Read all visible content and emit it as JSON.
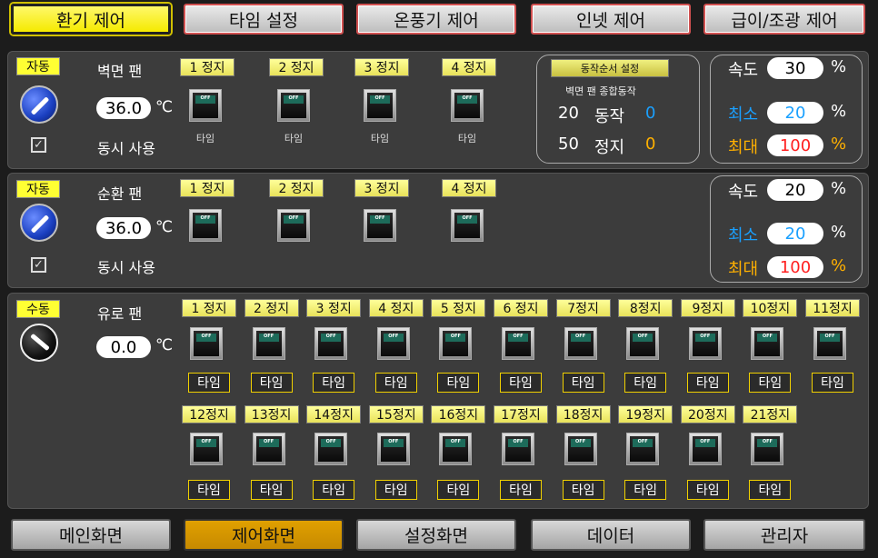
{
  "top_tabs": [
    "환기 제어",
    "타임 설정",
    "온풍기 제어",
    "인넷 제어",
    "급이/조광 제어"
  ],
  "bottom_tabs": [
    "메인화면",
    "제어화면",
    "설정화면",
    "데이터",
    "관리자"
  ],
  "panel1": {
    "mode": "자동",
    "title": "벽면 팬",
    "temp": "36.0",
    "unit": "℃",
    "sync_label": "동시 사용",
    "stops": [
      "1 정지",
      "2 정지",
      "3 정지",
      "4 정지"
    ],
    "switch_text": "OFF",
    "timer_label": "타임",
    "sequence_button": "동작순서 설정",
    "sequence_title": "벽면 팬 종합동작",
    "run_count": "20",
    "run_label": "동작",
    "run_value": "0",
    "stop_count": "50",
    "stop_label": "정지",
    "stop_value": "0",
    "speed_label": "속도",
    "speed_value": "30",
    "min_label": "최소",
    "min_value": "20",
    "max_label": "최대",
    "max_value": "100",
    "pct": "%"
  },
  "panel2": {
    "mode": "자동",
    "title": "순환 팬",
    "temp": "36.0",
    "unit": "℃",
    "sync_label": "동시 사용",
    "stops": [
      "1 정지",
      "2 정지",
      "3 정지",
      "4 정지"
    ],
    "switch_text": "OFF",
    "speed_label": "속도",
    "speed_value": "20",
    "min_label": "최소",
    "min_value": "20",
    "max_label": "최대",
    "max_value": "100",
    "pct": "%"
  },
  "panel3": {
    "mode": "수동",
    "title": "유로 팬",
    "temp": "0.0",
    "unit": "℃",
    "switch_text": "OFF",
    "timer_label": "타임",
    "row1_stops": [
      "1 정지",
      "2 정지",
      "3 정지",
      "4 정지",
      "5 정지",
      "6 정지",
      "7정지",
      "8정지",
      "9정지",
      "10정지",
      "11정지"
    ],
    "row2_stops": [
      "12정지",
      "13정지",
      "14정지",
      "15정지",
      "16정지",
      "17정지",
      "18정지",
      "19정지",
      "20정지",
      "21정지"
    ]
  }
}
